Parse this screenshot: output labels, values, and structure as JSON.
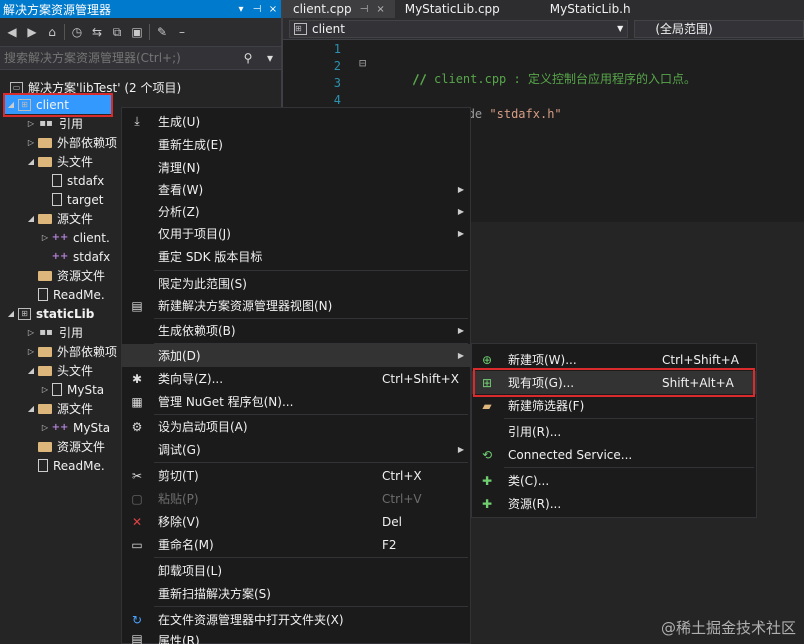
{
  "solution_explorer": {
    "title": "解决方案资源管理器",
    "title_buttons": [
      "▾",
      "⊣",
      "×"
    ],
    "search_placeholder": "搜索解决方案资源管理器(Ctrl+;)",
    "tree": [
      {
        "label": "解决方案'libTest' (2 个项目)",
        "icon": "solution-icon"
      },
      {
        "label": "client",
        "icon": "project-icon"
      },
      {
        "label": "引用",
        "icon": "references-icon"
      },
      {
        "label": "外部依赖项",
        "icon": "external-deps-icon"
      },
      {
        "label": "头文件",
        "icon": "folder-icon"
      },
      {
        "label": "stdafx",
        "icon": "header-file-icon"
      },
      {
        "label": "target",
        "icon": "header-file-icon"
      },
      {
        "label": "源文件",
        "icon": "folder-icon"
      },
      {
        "label": "client.",
        "icon": "cpp-file-icon"
      },
      {
        "label": "stdafx",
        "icon": "cpp-file-icon"
      },
      {
        "label": "资源文件",
        "icon": "folder-icon"
      },
      {
        "label": "ReadMe.",
        "icon": "text-file-icon"
      },
      {
        "label": "staticLib",
        "icon": "project-icon"
      },
      {
        "label": "引用",
        "icon": "references-icon"
      },
      {
        "label": "外部依赖项",
        "icon": "external-deps-icon"
      },
      {
        "label": "头文件",
        "icon": "folder-icon"
      },
      {
        "label": "MySta",
        "icon": "header-file-icon"
      },
      {
        "label": "源文件",
        "icon": "folder-icon"
      },
      {
        "label": "MySta",
        "icon": "cpp-file-icon"
      },
      {
        "label": "资源文件",
        "icon": "folder-icon"
      },
      {
        "label": "ReadMe.",
        "icon": "text-file-icon"
      }
    ]
  },
  "editor": {
    "tabs": [
      {
        "label": "client.cpp"
      },
      {
        "label": "MyStaticLib.cpp"
      },
      {
        "label": "MyStaticLib.h"
      }
    ],
    "tab_pin": "⊣",
    "tab_close": "×",
    "nav_project": "client",
    "nav_scope": "(全局范围)",
    "lines": [
      {
        "n": "1",
        "text": "// client.cpp : 定义控制台应用程序的入口点。"
      },
      {
        "n": "2",
        "text": "//"
      },
      {
        "n": "3",
        "text": ""
      },
      {
        "n": "4",
        "text_pre": "#include ",
        "text_str": "\"stdafx.h\""
      }
    ]
  },
  "context_menu": [
    {
      "label": "生成(U)",
      "icon": "build-icon"
    },
    {
      "label": "重新生成(E)"
    },
    {
      "label": "清理(N)"
    },
    {
      "label": "查看(W)",
      "submenu": true
    },
    {
      "label": "分析(Z)",
      "submenu": true
    },
    {
      "label": "仅用于项目(J)",
      "submenu": true
    },
    {
      "label": "重定 SDK 版本目标"
    },
    {
      "label": "限定为此范围(S)"
    },
    {
      "label": "新建解决方案资源管理器视图(N)",
      "icon": "new-view-icon"
    },
    {
      "label": "生成依赖项(B)",
      "submenu": true
    },
    {
      "label": "添加(D)",
      "submenu": true
    },
    {
      "label": "类向导(Z)...",
      "shortcut": "Ctrl+Shift+X",
      "icon": "class-wizard-icon"
    },
    {
      "label": "管理 NuGet 程序包(N)...",
      "icon": "nuget-icon"
    },
    {
      "label": "设为启动项目(A)",
      "icon": "gear-icon"
    },
    {
      "label": "调试(G)",
      "submenu": true
    },
    {
      "label": "剪切(T)",
      "shortcut": "Ctrl+X",
      "icon": "scissors-icon"
    },
    {
      "label": "粘贴(P)",
      "shortcut": "Ctrl+V",
      "icon": "paste-icon",
      "disabled": true
    },
    {
      "label": "移除(V)",
      "shortcut": "Del",
      "icon": "remove-icon"
    },
    {
      "label": "重命名(M)",
      "shortcut": "F2",
      "icon": "rename-icon"
    },
    {
      "label": "卸载项目(L)"
    },
    {
      "label": "重新扫描解决方案(S)"
    },
    {
      "label": "在文件资源管理器中打开文件夹(X)",
      "icon": "refresh-folder-icon"
    },
    {
      "label": "属性(R)",
      "icon": "properties-icon"
    }
  ],
  "add_submenu": [
    {
      "label": "新建项(W)...",
      "shortcut": "Ctrl+Shift+A",
      "icon": "new-item-icon"
    },
    {
      "label": "现有项(G)...",
      "shortcut": "Shift+Alt+A",
      "icon": "existing-item-icon"
    },
    {
      "label": "新建筛选器(F)",
      "icon": "new-filter-icon"
    },
    {
      "label": "引用(R)..."
    },
    {
      "label": "Connected Service...",
      "icon": "connected-service-icon"
    },
    {
      "label": "类(C)...",
      "icon": "class-icon"
    },
    {
      "label": "资源(R)...",
      "icon": "resource-icon"
    }
  ],
  "watermark": "@稀土掘金技术社区",
  "colors": {
    "accent": "#007acc",
    "selection": "#3399ff",
    "highlight_box": "#d92b2b"
  }
}
